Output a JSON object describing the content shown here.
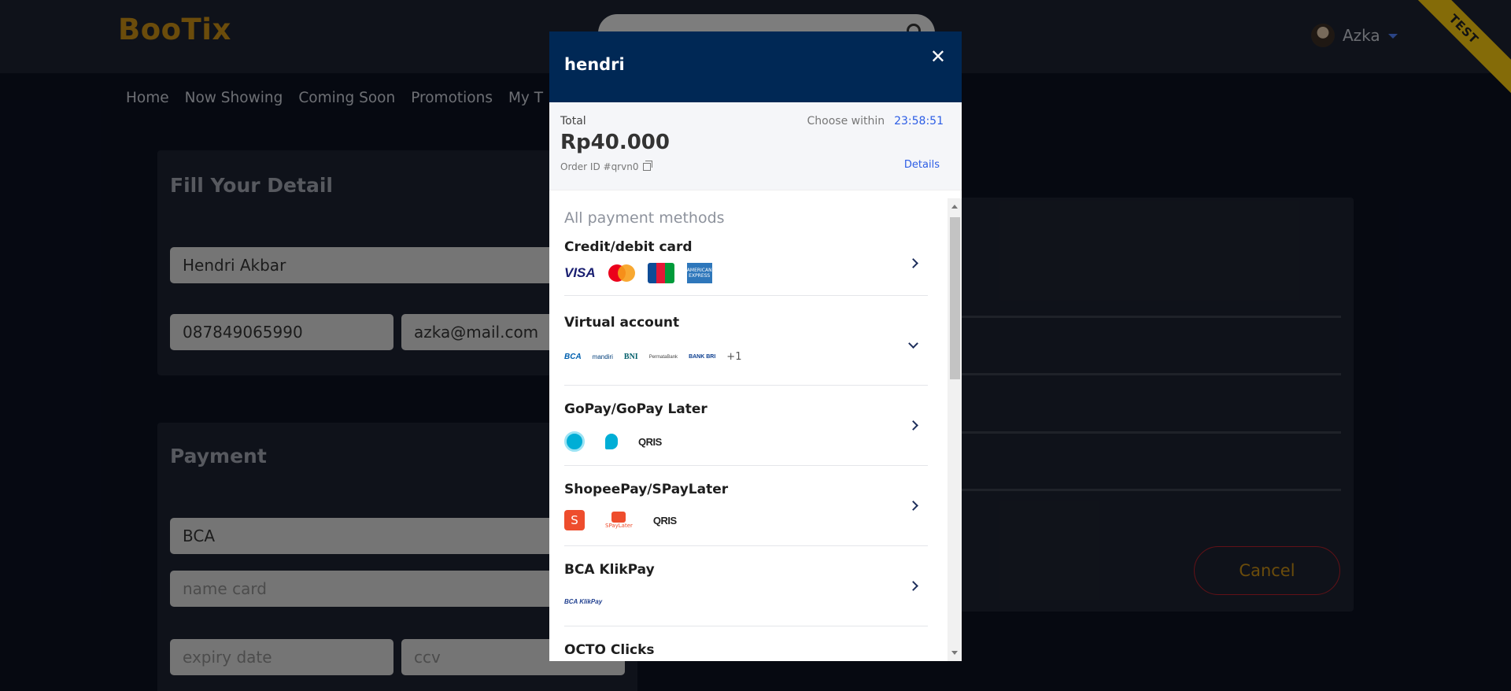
{
  "app": {
    "brand": "BooTix",
    "user_name": "Azka",
    "env_badge": "TEST"
  },
  "nav": [
    "Home",
    "Now Showing",
    "Coming Soon",
    "Promotions",
    "My T"
  ],
  "detail_form": {
    "title": "Fill Your Detail",
    "name_value": "Hendri Akbar",
    "phone_value": "087849065990",
    "email_value": "azka@mail.com"
  },
  "payment_form": {
    "title": "Payment",
    "bank_value": "BCA",
    "name_card_placeholder": "name card",
    "expiry_placeholder": "expiry date",
    "ccv_placeholder": "ccv"
  },
  "side_panel": {
    "cancel_label": "Cancel"
  },
  "modal": {
    "title": "hendri",
    "total_label": "Total",
    "amount": "Rp40.000",
    "order_id": "Order ID #qrvn0",
    "choose_within_label": "Choose within",
    "countdown": "23:58:51",
    "details_label": "Details",
    "section_title": "All payment methods",
    "methods": [
      {
        "name": "Credit/debit card",
        "logos": [
          "VISA",
          "mastercard",
          "JCB",
          "AMERICAN EXPRESS"
        ]
      },
      {
        "name": "Virtual account",
        "logos": [
          "BCA",
          "mandiri",
          "BNI",
          "PermataBank",
          "BANK BRI"
        ],
        "extra": "+1"
      },
      {
        "name": "GoPay/GoPay Later",
        "logos": [
          "gopay",
          "gopaylater",
          "QRIS"
        ]
      },
      {
        "name": "ShopeePay/SPayLater",
        "logos": [
          "shopeepay",
          "SPayLater",
          "QRIS"
        ]
      },
      {
        "name": "BCA KlikPay",
        "logos": [
          "BCA KlikPay"
        ]
      },
      {
        "name": "OCTO Clicks"
      }
    ]
  },
  "colors": {
    "brand": "#c38a14",
    "modal_header": "#002855",
    "countdown": "#2c5de5",
    "cancel_border": "#b1202a"
  }
}
